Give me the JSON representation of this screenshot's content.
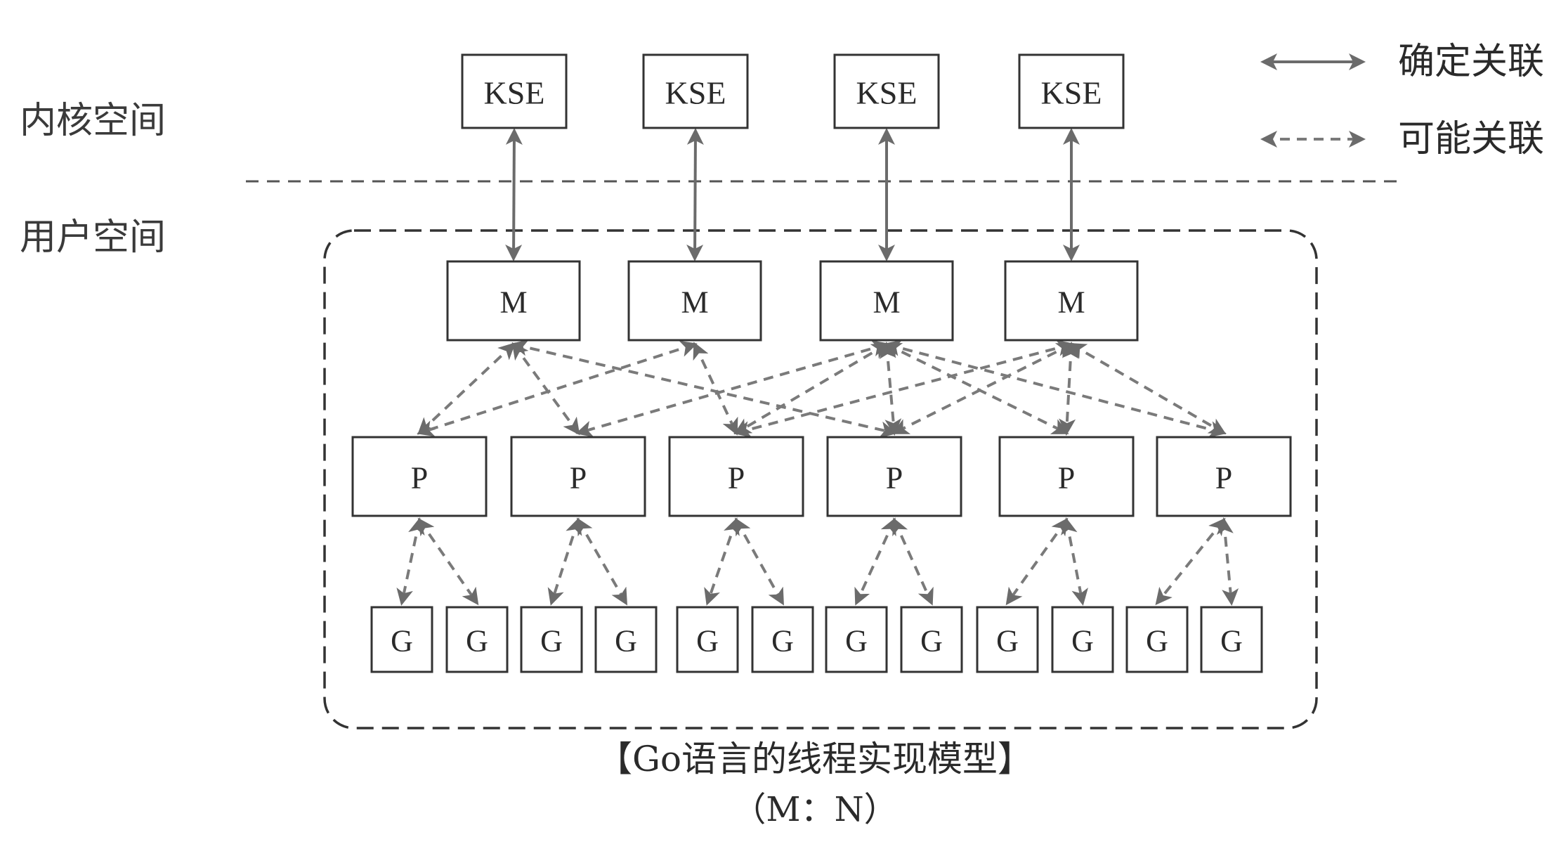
{
  "regions": {
    "kernel_label": "内核空间",
    "user_label": "用户空间"
  },
  "legend": {
    "definite_label": "确定关联",
    "possible_label": "可能关联"
  },
  "nodes": {
    "kse": [
      {
        "label": "KSE"
      },
      {
        "label": "KSE"
      },
      {
        "label": "KSE"
      },
      {
        "label": "KSE"
      }
    ],
    "m": [
      {
        "label": "M"
      },
      {
        "label": "M"
      },
      {
        "label": "M"
      },
      {
        "label": "M"
      }
    ],
    "p": [
      {
        "label": "P"
      },
      {
        "label": "P"
      },
      {
        "label": "P"
      },
      {
        "label": "P"
      },
      {
        "label": "P"
      },
      {
        "label": "P"
      }
    ],
    "g": [
      {
        "label": "G"
      },
      {
        "label": "G"
      },
      {
        "label": "G"
      },
      {
        "label": "G"
      },
      {
        "label": "G"
      },
      {
        "label": "G"
      },
      {
        "label": "G"
      },
      {
        "label": "G"
      },
      {
        "label": "G"
      },
      {
        "label": "G"
      },
      {
        "label": "G"
      },
      {
        "label": "G"
      }
    ]
  },
  "links": {
    "kse_m": [
      [
        0,
        0
      ],
      [
        1,
        1
      ],
      [
        2,
        2
      ],
      [
        3,
        3
      ]
    ],
    "m_p": [
      [
        0,
        0
      ],
      [
        0,
        1
      ],
      [
        0,
        3
      ],
      [
        1,
        0
      ],
      [
        1,
        2
      ],
      [
        2,
        1
      ],
      [
        2,
        2
      ],
      [
        2,
        3
      ],
      [
        2,
        4
      ],
      [
        2,
        5
      ],
      [
        3,
        2
      ],
      [
        3,
        3
      ],
      [
        3,
        4
      ],
      [
        3,
        5
      ]
    ],
    "p_g": [
      [
        0,
        0
      ],
      [
        0,
        1
      ],
      [
        1,
        2
      ],
      [
        1,
        3
      ],
      [
        2,
        4
      ],
      [
        2,
        5
      ],
      [
        3,
        6
      ],
      [
        3,
        7
      ],
      [
        4,
        8
      ],
      [
        4,
        9
      ],
      [
        5,
        10
      ],
      [
        5,
        11
      ]
    ]
  },
  "caption": {
    "title": "【Go语言的线程实现模型】",
    "ratio": "（M：N）"
  },
  "colors": {
    "box_stroke": "#333333",
    "link": "#6b6b6b",
    "text": "#2a2a2a"
  }
}
